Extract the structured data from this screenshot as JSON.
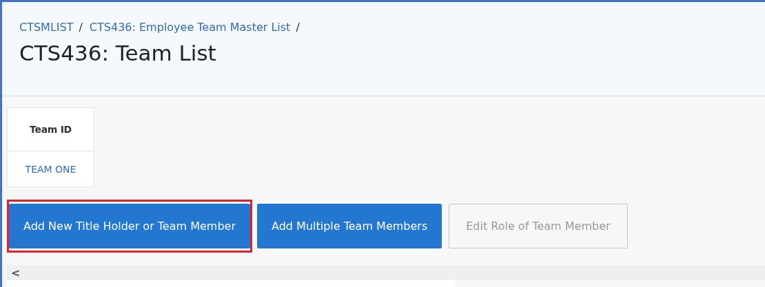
{
  "breadcrumb": [
    {
      "label": "CTSMLIST"
    },
    {
      "label": "CTS436: Employee Team Master List"
    }
  ],
  "separator": "/",
  "title": "CTS436: Team List",
  "table": {
    "columns": [
      "Team ID"
    ],
    "rows": [
      [
        "TEAM ONE"
      ]
    ]
  },
  "buttons": [
    {
      "label": "Add New Title Holder or Team Member",
      "disabled": false,
      "highlighted": true
    },
    {
      "label": "Add Multiple Team Members",
      "disabled": false,
      "highlighted": false
    },
    {
      "label": "Edit Role of Team Member",
      "disabled": true,
      "highlighted": false
    }
  ],
  "scrollbar": {
    "left_arrow": "<"
  }
}
